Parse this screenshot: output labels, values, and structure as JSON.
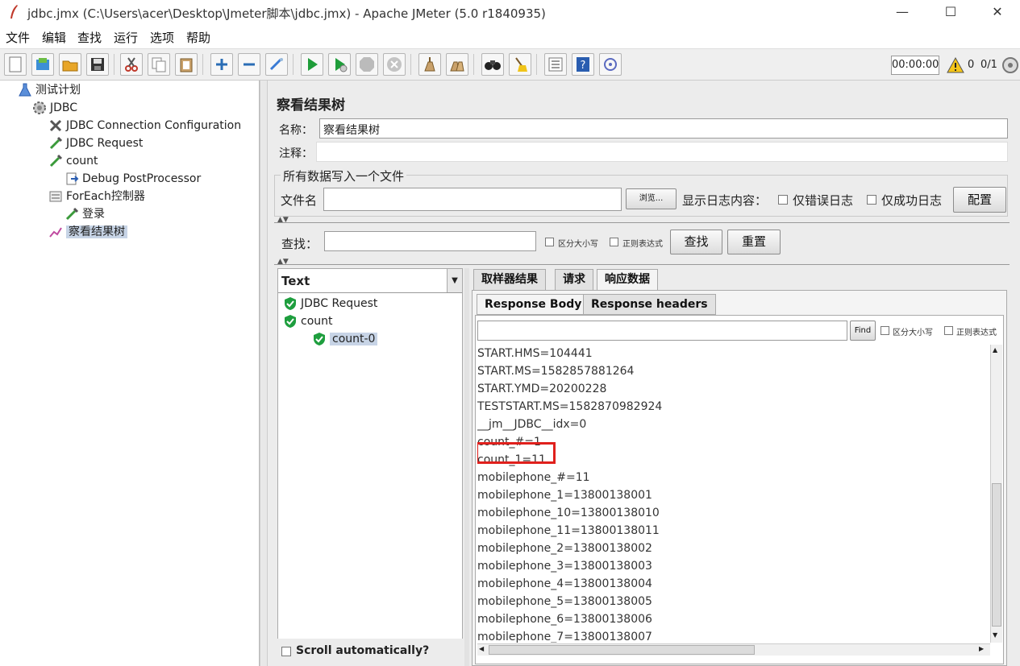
{
  "window": {
    "title": "jdbc.jmx (C:\\Users\\acer\\Desktop\\Jmeter脚本\\jdbc.jmx) - Apache JMeter (5.0 r1840935)",
    "minimize": "—",
    "maximize": "☐",
    "close": "✕"
  },
  "menu": [
    "文件",
    "编辑",
    "查找",
    "运行",
    "选项",
    "帮助"
  ],
  "toolbar": {
    "timer": "00:00:00",
    "warnings": "0",
    "threads": "0/1"
  },
  "tree": [
    {
      "label": "测试计划",
      "icon": "flask-icon"
    },
    {
      "label": "JDBC",
      "icon": "gear-icon"
    },
    {
      "label": "JDBC Connection Configuration",
      "icon": "wrench-icon"
    },
    {
      "label": "JDBC Request",
      "icon": "pipette-icon"
    },
    {
      "label": "count",
      "icon": "pipette-icon"
    },
    {
      "label": "Debug PostProcessor",
      "icon": "document-arrow-icon"
    },
    {
      "label": "ForEach控制器",
      "icon": "controller-icon"
    },
    {
      "label": "登录",
      "icon": "pipette-icon"
    },
    {
      "label": "察看结果树",
      "icon": "chart-icon"
    }
  ],
  "panel": {
    "title": "察看结果树",
    "name_label": "名称：",
    "name_value": "察看结果树",
    "comment_label": "注释：",
    "file_group_title": "所有数据写入一个文件",
    "filename_label": "文件名",
    "browse_label": "浏览...",
    "show_log_label": "显示日志内容：",
    "errors_only_label": "仅错误日志",
    "success_only_label": "仅成功日志",
    "config_label": "配置",
    "search_label": "查找：",
    "case_sensitive_label": "区分大小写",
    "regex_label": "正则表达式",
    "search_button": "查找",
    "reset_button": "重置"
  },
  "results": {
    "renderer": "Text",
    "samples": [
      {
        "label": "JDBC Request",
        "status": "success"
      },
      {
        "label": "count",
        "status": "success"
      },
      {
        "label": "count-0",
        "status": "success"
      }
    ],
    "scroll_auto_label": "Scroll automatically?",
    "tabs": [
      "取样器结果",
      "请求",
      "响应数据"
    ],
    "subtabs": [
      "Response Body",
      "Response headers"
    ],
    "find_label": "Find",
    "case_sensitive_label": "区分大小写",
    "regex_label": "正则表达式",
    "lines": [
      "START.HMS=104441",
      "START.MS=1582857881264",
      "START.YMD=20200228",
      "TESTSTART.MS=1582870982924",
      "__jm__JDBC__idx=0",
      "count_#=1",
      "count_1=11",
      "mobilephone_#=11",
      "mobilephone_1=13800138001",
      "mobilephone_10=13800138010",
      "mobilephone_11=13800138011",
      "mobilephone_2=13800138002",
      "mobilephone_3=13800138003",
      "mobilephone_4=13800138004",
      "mobilephone_5=13800138005",
      "mobilephone_6=13800138006",
      "mobilephone_7=13800138007"
    ],
    "highlight_color": "#e0201c"
  }
}
